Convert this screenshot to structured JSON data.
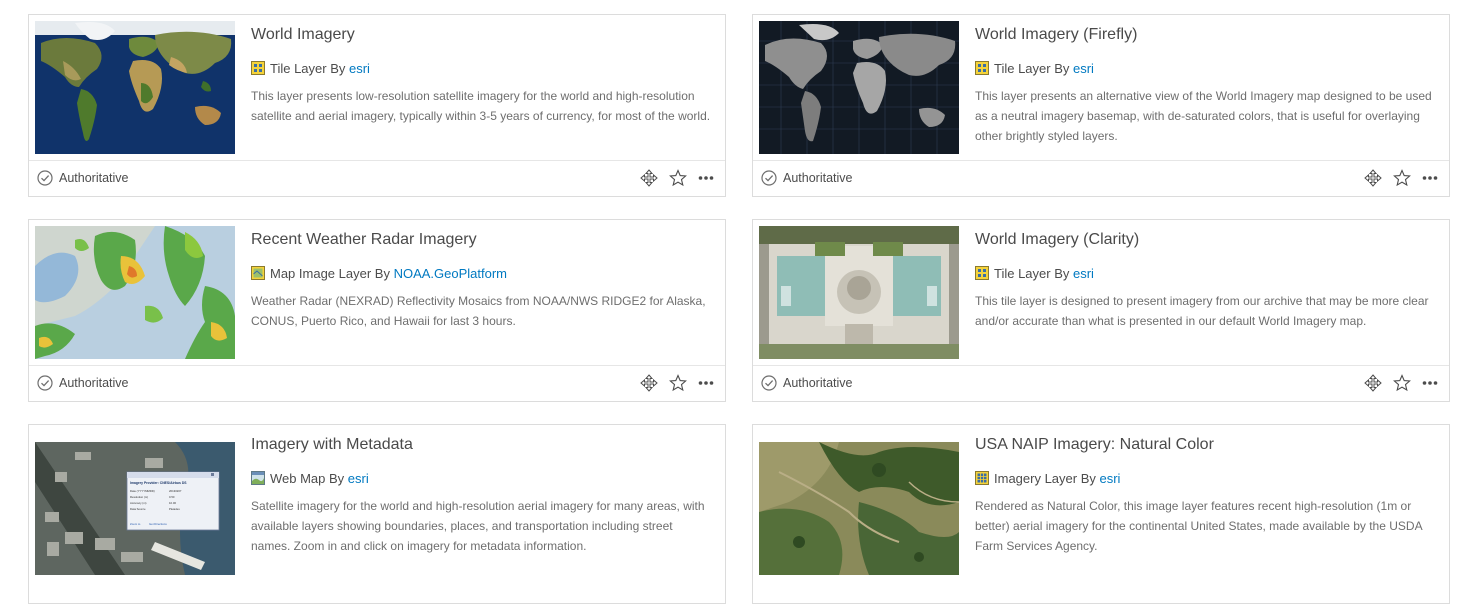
{
  "cards": [
    {
      "title": "World Imagery",
      "type_label": "Tile Layer By ",
      "owner": "esri",
      "type_icon": "tile-layer-icon",
      "description": "This layer presents low-resolution satellite imagery for the world and high-resolution satellite and aerial imagery, typically within 3-5 years of currency, for most of the world.",
      "status": "Authoritative"
    },
    {
      "title": "World Imagery (Firefly)",
      "type_label": "Tile Layer By ",
      "owner": "esri",
      "type_icon": "tile-layer-icon",
      "description": "This layer presents an alternative view of the World Imagery map designed to be used as a neutral imagery basemap, with de-saturated colors, that is useful for overlaying other brightly styled layers.",
      "status": "Authoritative"
    },
    {
      "title": "Recent Weather Radar Imagery",
      "type_label": "Map Image Layer By ",
      "owner": "NOAA.GeoPlatform",
      "type_icon": "map-image-layer-icon",
      "description": "Weather Radar (NEXRAD) Reflectivity Mosaics from NOAA/NWS RIDGE2 for Alaska, CONUS, Puerto Rico, and Hawaii for last 3 hours.",
      "status": "Authoritative"
    },
    {
      "title": "World Imagery (Clarity)",
      "type_label": "Tile Layer By ",
      "owner": "esri",
      "type_icon": "tile-layer-icon",
      "description": "This tile layer is designed to present imagery from our archive that may be more clear and/or accurate than what is presented in our default World Imagery map.",
      "status": "Authoritative"
    },
    {
      "title": "Imagery with Metadata",
      "type_label": "Web Map By ",
      "owner": "esri",
      "type_icon": "web-map-icon",
      "description": "Satellite imagery for the world and high-resolution aerial imagery for many areas, with available layers showing boundaries, places, and transportation including street names. Zoom in and click on imagery for metadata information.",
      "popup": {
        "header": "Imagery Provider: CNES/Airbus DS",
        "rows": [
          [
            "Date (YYYYMMDD)",
            "20130207"
          ],
          [
            "Resolution (m)",
            "0.50"
          ],
          [
            "Accuracy (m)",
            "10.00"
          ],
          [
            "Data Source",
            "Pleiades"
          ]
        ],
        "zoom": "Zoom to",
        "directions": "Get Directions"
      }
    },
    {
      "title": "USA NAIP Imagery: Natural Color",
      "type_label": "Imagery Layer By ",
      "owner": "esri",
      "type_icon": "imagery-layer-icon",
      "description": "Rendered as Natural Color, this image layer features recent high-resolution (1m or better) aerial imagery for the continental United States, made available by the USDA Farm Services Agency."
    }
  ],
  "icons": {
    "status": "check-circle-icon",
    "move": "move-icon",
    "favorite": "star-icon",
    "more": "more-options-icon"
  },
  "colors": {
    "link": "#0079c1",
    "text": "#4c4c4c",
    "border": "#dcdcdc"
  }
}
